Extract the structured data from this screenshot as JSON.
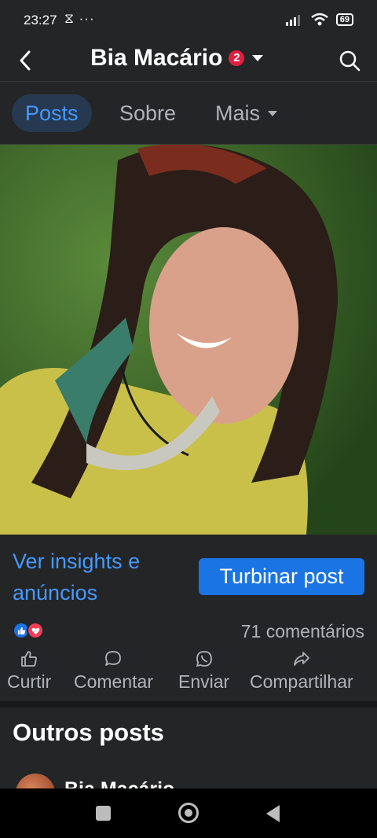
{
  "status": {
    "time": "23:27",
    "extra": "⧖ ···",
    "battery": "69"
  },
  "header": {
    "title": "Bia Macário",
    "badge": "2"
  },
  "tabs": [
    {
      "label": "Posts"
    },
    {
      "label": "Sobre"
    },
    {
      "label": "Mais"
    }
  ],
  "post": {
    "insights_line1": "Ver insights e",
    "insights_line2": "anúncios",
    "boost_label": "Turbinar post",
    "comments": "71 comentários"
  },
  "actions": [
    {
      "label": "Curtir",
      "icon": "like-icon"
    },
    {
      "label": "Comentar",
      "icon": "comment-icon"
    },
    {
      "label": "Enviar",
      "icon": "whatsapp-icon"
    },
    {
      "label": "Compartilhar",
      "icon": "share-icon"
    }
  ],
  "others": {
    "title": "Outros posts",
    "peek_name": "Bia Macário"
  },
  "colors": {
    "accent": "#4599ff",
    "button": "#1b74e4",
    "background": "#242526",
    "badge": "#e41e3f"
  }
}
